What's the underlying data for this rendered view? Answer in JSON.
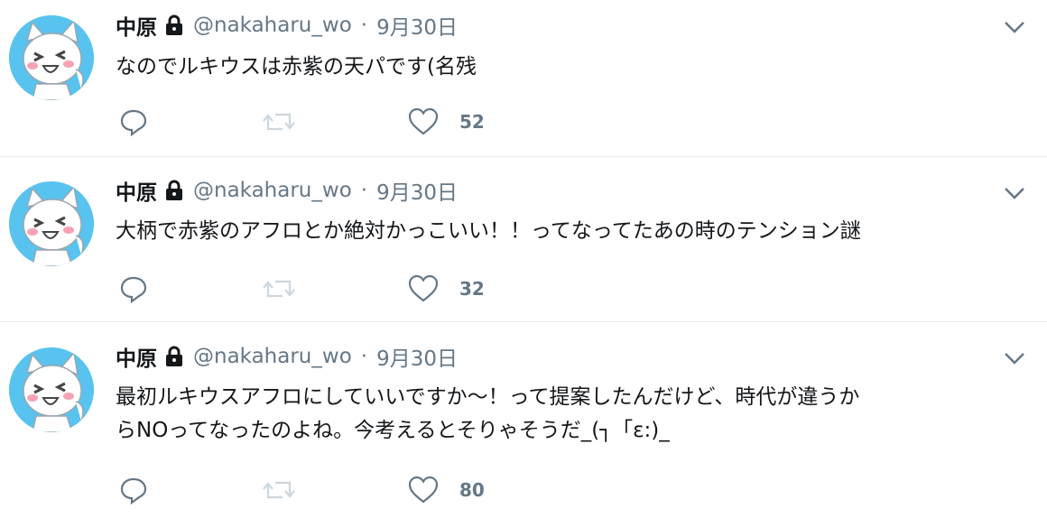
{
  "tweets": [
    {
      "author": "中原",
      "handle": "@nakaharu_wo",
      "separator": "·",
      "date": "9月30日",
      "lines": [
        "なのでルキウスは赤紫の天パです(名残"
      ],
      "like_count": "52",
      "protected": true
    },
    {
      "author": "中原",
      "handle": "@nakaharu_wo",
      "separator": "·",
      "date": "9月30日",
      "lines": [
        "大柄で赤紫のアフロとか絶対かっこいい！！ってなってたあの時のテンション謎"
      ],
      "like_count": "32",
      "protected": true
    },
    {
      "author": "中原",
      "handle": "@nakaharu_wo",
      "separator": "·",
      "date": "9月30日",
      "lines": [
        "最初ルキウスアフロにしていいですか〜！って提案したんだけど、時代が違うか",
        "らNOってなったのよね。今考えるとそりゃそうだ_(┐「ε:)_"
      ],
      "like_count": "80",
      "protected": true
    }
  ],
  "icons": {
    "avatar": "cat-avatar-icon",
    "lock": "lock-icon",
    "caret": "chevron-down-icon",
    "reply": "reply-icon",
    "retweet": "retweet-icon",
    "like": "heart-icon"
  },
  "colors": {
    "avatar_bg": "#58c3ef",
    "text": "#14171a",
    "muted": "#657786",
    "retweet_disabled": "#ccd6dd",
    "divider": "#e6ecf0"
  }
}
